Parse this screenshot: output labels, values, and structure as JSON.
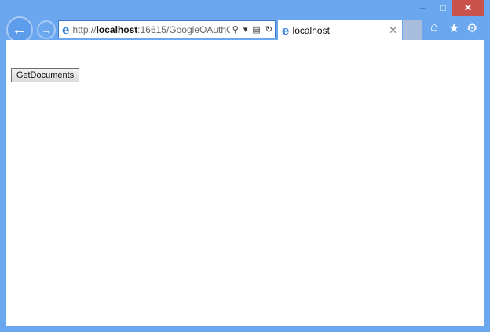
{
  "window": {
    "minimize": "–",
    "maximize": "□",
    "close": "✕"
  },
  "nav": {
    "back": "←",
    "forward": "→"
  },
  "address": {
    "prefix": "http://",
    "host": "localhost",
    "rest": ":16615/GoogleOAuthC",
    "search": "⚲",
    "dropdown": "▾",
    "compat": "▤",
    "refresh": "↻"
  },
  "tab": {
    "title": "localhost",
    "close": "✕"
  },
  "toolbar": {
    "home": "⌂",
    "favorites": "★",
    "settings": "⚙"
  },
  "page": {
    "button_label": "GetDocuments"
  }
}
